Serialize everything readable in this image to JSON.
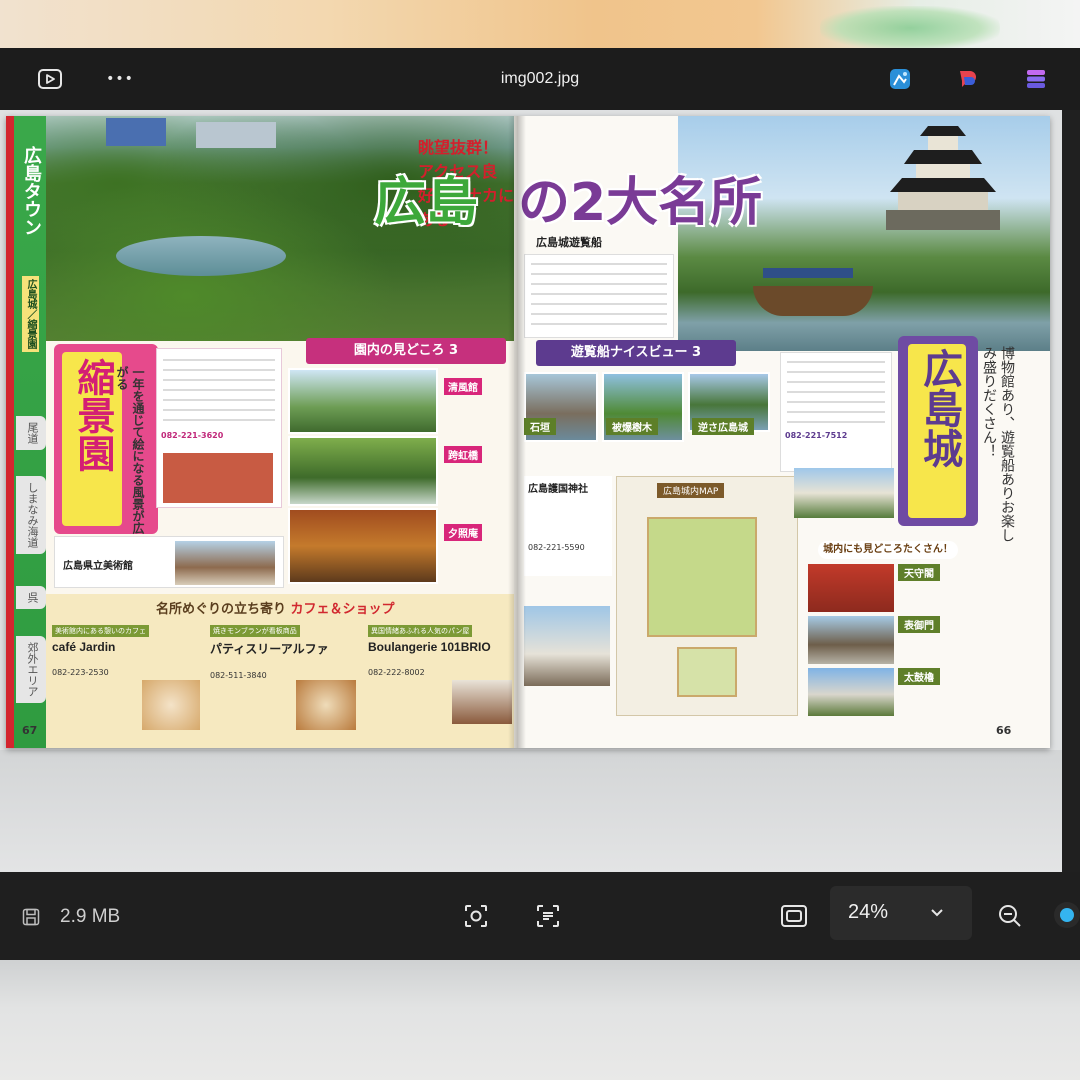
{
  "window": {
    "title": "img002.jpg",
    "more_label": "•••"
  },
  "book": {
    "left_page": {
      "side_title": "広島タウン",
      "side_subtitle": "広島城／縮景園",
      "side_nav": [
        "尾道",
        "しまなみ海道",
        "呉",
        "郊外エリア"
      ],
      "headline_tag": "眺望抜群！アクセス良好！街ナカにある",
      "headline_green": "広島",
      "headline_purple": "の2大名所",
      "section_banner": "園内の見どころ 3",
      "spot_name": "縮景園",
      "spot_catch": "一年を通じて絵になる風景が広がる",
      "tel": "082-221-3620",
      "spots": [
        "清風館",
        "跨虹橋",
        "夕照庵"
      ],
      "nearby_label": "広島県立美術館",
      "cafe_section_title": "名所めぐりの立ち寄り",
      "cafe_section_accent": "カフェ＆ショップ",
      "cafes": [
        {
          "head": "美術館内にある憩いのカフェ",
          "name": "café Jardin",
          "tel": "082-223-2530"
        },
        {
          "head": "焼きモンブランが看板商品",
          "name": "パティスリーアルファ",
          "tel": "082-511-3840"
        },
        {
          "head": "異国情緒あふれる人気のパン屋",
          "name": "Boulangerie 101BRIO",
          "tel": "082-222-8002"
        }
      ],
      "page_number": "67"
    },
    "right_page": {
      "boat_heading": "広島城遊覧船",
      "section_banner": "遊覧船ナイスビュー 3",
      "views": [
        "石垣",
        "被爆樹木",
        "逆さ広島城"
      ],
      "shrine_label": "広島護国神社",
      "shrine_tel": "082-221-5590",
      "map_title": "広島城内MAP",
      "spot_name": "広島城",
      "spot_catch": "博物館あり、遊覧船ありお楽しみ盛りだくさん！",
      "tel": "082-221-7512",
      "inner_title": "城内にも見どころたくさん！",
      "inner_items": [
        "天守閣",
        "表御門",
        "太鼓櫓"
      ],
      "page_number": "66"
    }
  },
  "bottombar": {
    "file_size": "2.9 MB",
    "zoom": "24%"
  },
  "colors": {
    "titlebar": "#1c1c1c",
    "accent_blue": "#34b4f0",
    "green": "#3da83a",
    "purple": "#7a3b96",
    "pink": "#e64a8c"
  }
}
